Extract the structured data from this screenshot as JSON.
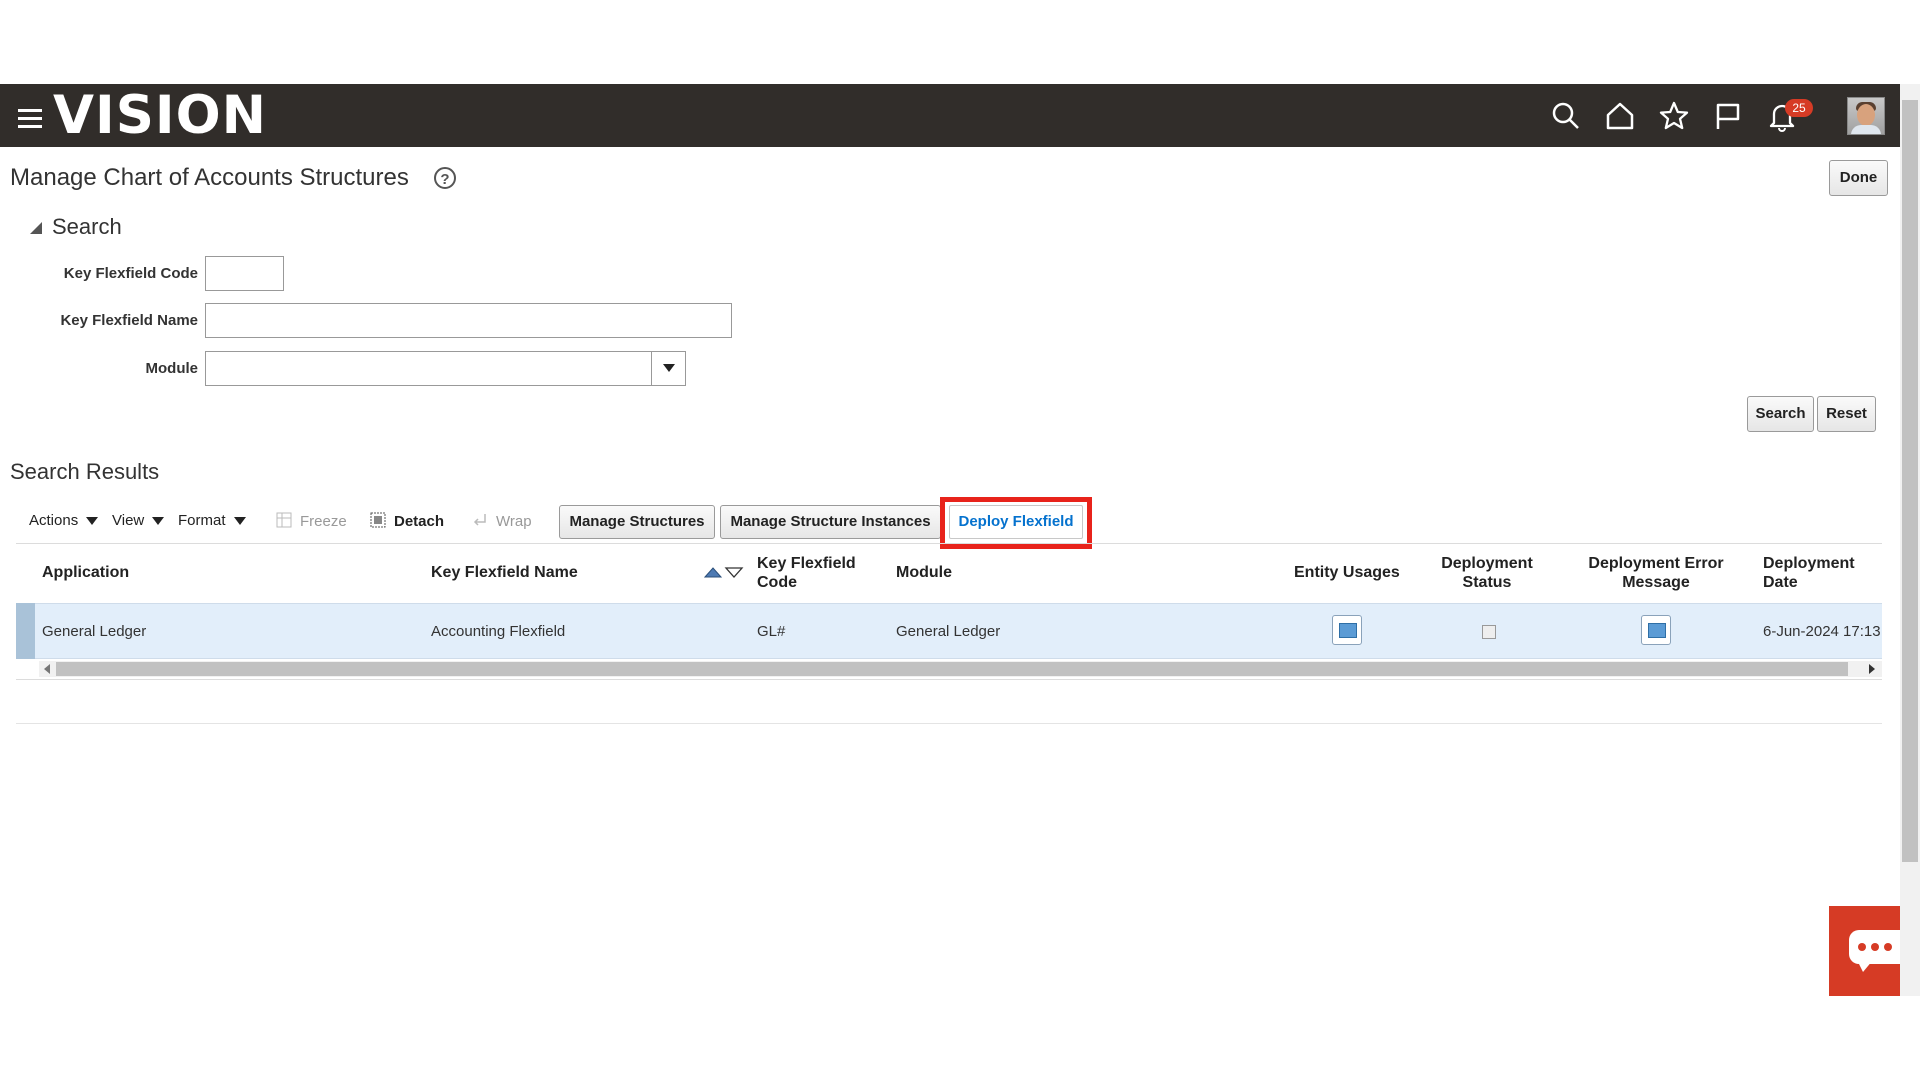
{
  "header": {
    "logo_text": "VISION",
    "notification_count": "25",
    "icons": [
      "menu-icon",
      "search-icon",
      "home-icon",
      "star-icon",
      "flag-icon",
      "bell-icon",
      "avatar"
    ],
    "bar_color": "#312d2a"
  },
  "page": {
    "title": "Manage Chart of Accounts Structures",
    "done_label": "Done"
  },
  "search": {
    "section_label": "Search",
    "fields": {
      "code_label": "Key Flexfield Code",
      "code_value": "",
      "name_label": "Key Flexfield Name",
      "name_value": "",
      "module_label": "Module",
      "module_value": ""
    },
    "search_label": "Search",
    "reset_label": "Reset"
  },
  "results": {
    "title": "Search Results",
    "toolbar": {
      "actions": "Actions",
      "view": "View",
      "format": "Format",
      "freeze": "Freeze",
      "detach": "Detach",
      "wrap": "Wrap",
      "manage_structures": "Manage Structures",
      "manage_instances": "Manage Structure Instances",
      "deploy_flexfield": "Deploy Flexfield"
    },
    "columns": {
      "application": "Application",
      "kf_name": "Key Flexfield Name",
      "kf_code_1": "Key Flexfield",
      "kf_code_2": "Code",
      "module": "Module",
      "entity_usages": "Entity Usages",
      "dep_status_1": "Deployment",
      "dep_status_2": "Status",
      "dep_error_1": "Deployment Error",
      "dep_error_2": "Message",
      "dep_date_1": "Deployment",
      "dep_date_2": "Date"
    },
    "rows": [
      {
        "application": "General Ledger",
        "kf_name": "Accounting Flexfield",
        "kf_code": "GL#",
        "module": "General Ledger",
        "deployment_date": "6-Jun-2024 17:13"
      }
    ]
  },
  "colors": {
    "highlight": "#e8231b",
    "link_blue": "#0572ce",
    "selected_row": "#e2eefa",
    "chat_widget": "#d63b25"
  }
}
